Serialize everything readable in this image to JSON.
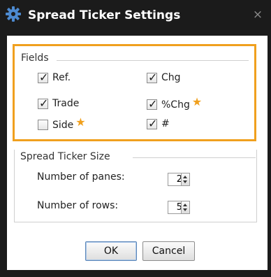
{
  "dialog": {
    "title": "Spread Ticker Settings",
    "close_glyph": "×"
  },
  "fields": {
    "label": "Fields",
    "items": [
      {
        "label": "Ref.",
        "checked": true,
        "starred": false
      },
      {
        "label": "Chg",
        "checked": true,
        "starred": false
      },
      {
        "label": "Trade",
        "checked": true,
        "starred": false
      },
      {
        "label": "%Chg",
        "checked": true,
        "starred": true
      },
      {
        "label": "Side",
        "checked": false,
        "starred": true
      },
      {
        "label": "#",
        "checked": true,
        "starred": false
      }
    ]
  },
  "size": {
    "label": "Spread Ticker Size",
    "panes_label": "Number of panes:",
    "panes_value": "2",
    "rows_label": "Number of rows:",
    "rows_value": "5"
  },
  "buttons": {
    "ok_label": "OK",
    "cancel_label": "Cancel"
  },
  "colors": {
    "accent": "#f0a01e",
    "titlebar_bg": "#1b1b1b"
  },
  "icons": {
    "title": "gear-icon",
    "close": "close-icon",
    "checkbox_tick": "check-icon",
    "star": "star-icon"
  }
}
